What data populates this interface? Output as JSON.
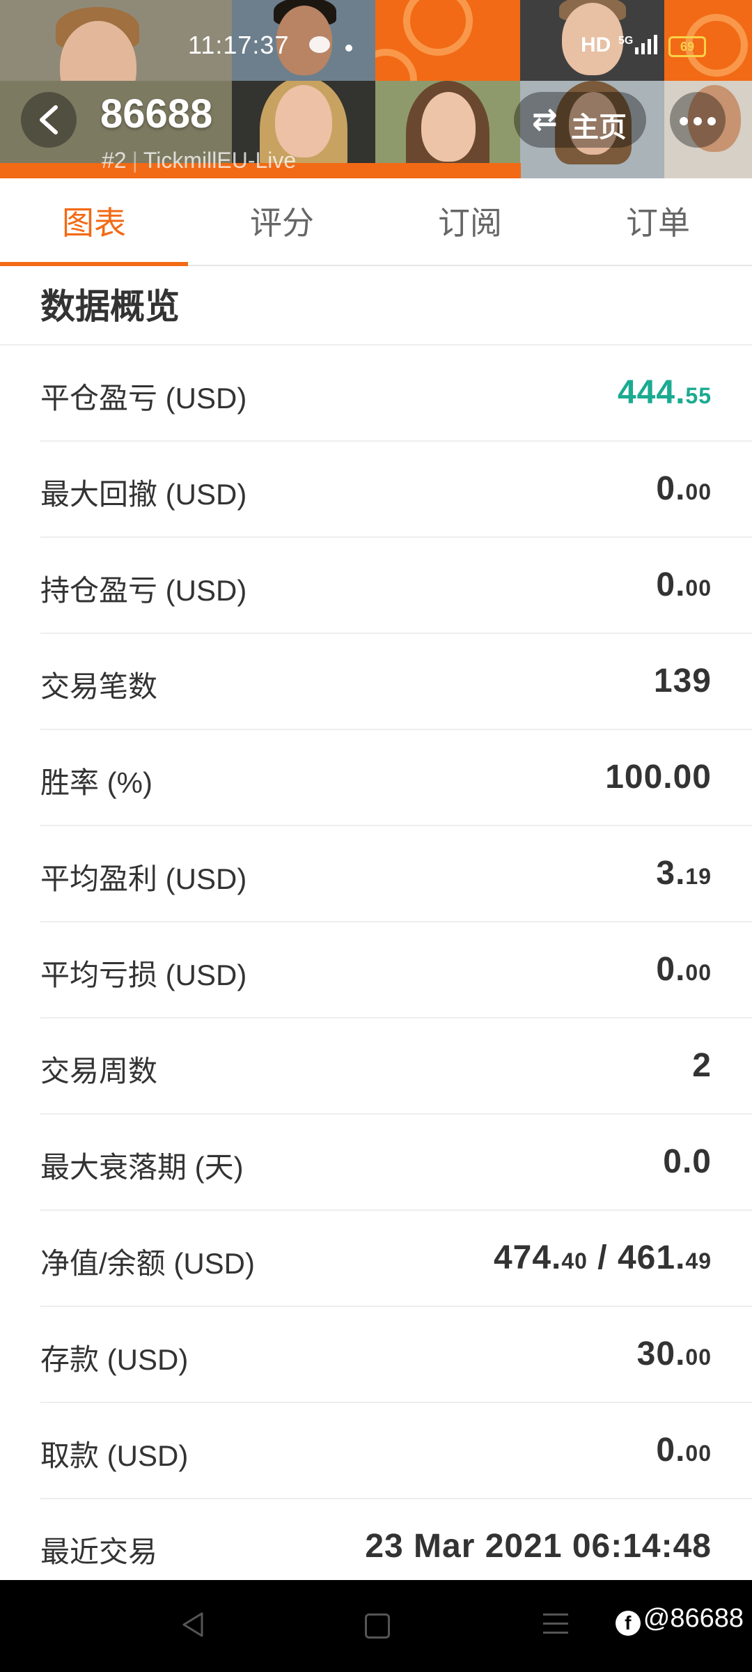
{
  "status_bar": {
    "time": "11:17:37",
    "network": "HD",
    "signal": "5G",
    "battery": "69"
  },
  "header": {
    "account": "86688",
    "rank": "#2",
    "broker": "TickmillEU-Live",
    "home_label": "主页",
    "accent_color": "#f26a15"
  },
  "tabs": [
    {
      "label": "图表",
      "active": true
    },
    {
      "label": "评分",
      "active": false
    },
    {
      "label": "订阅",
      "active": false
    },
    {
      "label": "订单",
      "active": false
    }
  ],
  "overview": {
    "title": "数据概览",
    "rows": [
      {
        "label": "平仓盈亏 (USD)",
        "int": "444.",
        "dec": "55",
        "color": "#1bab91"
      },
      {
        "label": "最大回撤 (USD)",
        "int": "0.",
        "dec": "00"
      },
      {
        "label": "持仓盈亏 (USD)",
        "int": "0.",
        "dec": "00"
      },
      {
        "label": "交易笔数",
        "int": "139",
        "dec": ""
      },
      {
        "label": "胜率 (%)",
        "int": "100.00",
        "dec": ""
      },
      {
        "label": "平均盈利 (USD)",
        "int": "3.",
        "dec": "19"
      },
      {
        "label": "平均亏损 (USD)",
        "int": "0.",
        "dec": "00"
      },
      {
        "label": "交易周数",
        "int": "2",
        "dec": ""
      },
      {
        "label": "最大衰落期 (天)",
        "int": "0.0",
        "dec": ""
      },
      {
        "label": "净值/余额 (USD)",
        "int": "474.",
        "dec": "40",
        "int2": " / 461.",
        "dec2": "49"
      },
      {
        "label": "存款 (USD)",
        "int": "30.",
        "dec": "00"
      },
      {
        "label": "取款 (USD)",
        "int": "0.",
        "dec": "00"
      },
      {
        "label": "最近交易",
        "int": "23 Mar 2021 06:14:48",
        "dec": ""
      }
    ]
  },
  "watermark": "@86688"
}
